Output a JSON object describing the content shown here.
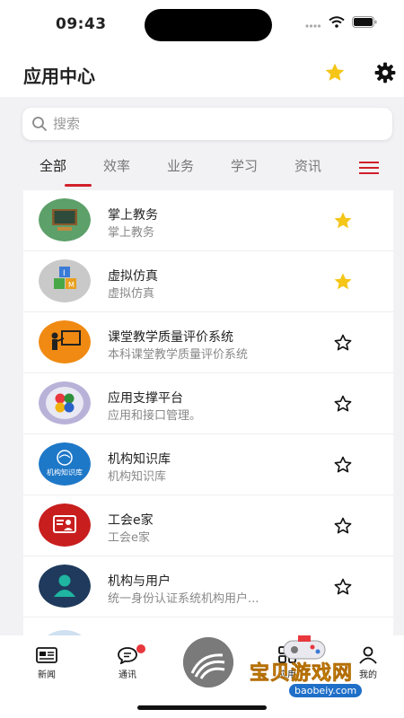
{
  "status_bar": {
    "time": "09:43"
  },
  "header": {
    "title": "应用中心"
  },
  "search": {
    "placeholder": "搜索"
  },
  "tabs": [
    "全部",
    "效率",
    "业务",
    "学习",
    "资讯"
  ],
  "apps": [
    {
      "name": "掌上教务",
      "desc": "掌上教务",
      "favorite": true,
      "icon": "blackboard-icon"
    },
    {
      "name": "虚拟仿真",
      "desc": "虚拟仿真",
      "favorite": true,
      "icon": "blocks-icon"
    },
    {
      "name": "课堂教学质量评价系统",
      "desc": "本科课堂教学质量评价系统",
      "favorite": false,
      "icon": "teacher-icon"
    },
    {
      "name": "应用支撑平台",
      "desc": "应用和接口管理。",
      "favorite": false,
      "icon": "platform-icon"
    },
    {
      "name": "机构知识库",
      "desc": "机构知识库",
      "favorite": false,
      "icon": "knowledge-base-icon",
      "icon_text": "机构知识库"
    },
    {
      "name": "工会e家",
      "desc": "工会e家",
      "favorite": false,
      "icon": "union-card-icon"
    },
    {
      "name": "机构与用户",
      "desc": "统一身份认证系统机构用户...",
      "favorite": false,
      "icon": "user-icon"
    }
  ],
  "tab_bar": {
    "items": [
      {
        "label": "新闻",
        "icon": "news-icon"
      },
      {
        "label": "通讯",
        "icon": "chat-icon",
        "badge": true
      },
      {
        "label": "",
        "icon": "center-logo-icon"
      },
      {
        "label": "应用",
        "icon": "apps-icon"
      },
      {
        "label": "我的",
        "icon": "profile-icon"
      }
    ]
  },
  "watermark": {
    "text": "宝贝游戏网",
    "url": "baobeiy.com"
  },
  "colors": {
    "accent": "#d0202a",
    "star": "#f5c518",
    "text": "#222222",
    "subtext": "#888888"
  }
}
